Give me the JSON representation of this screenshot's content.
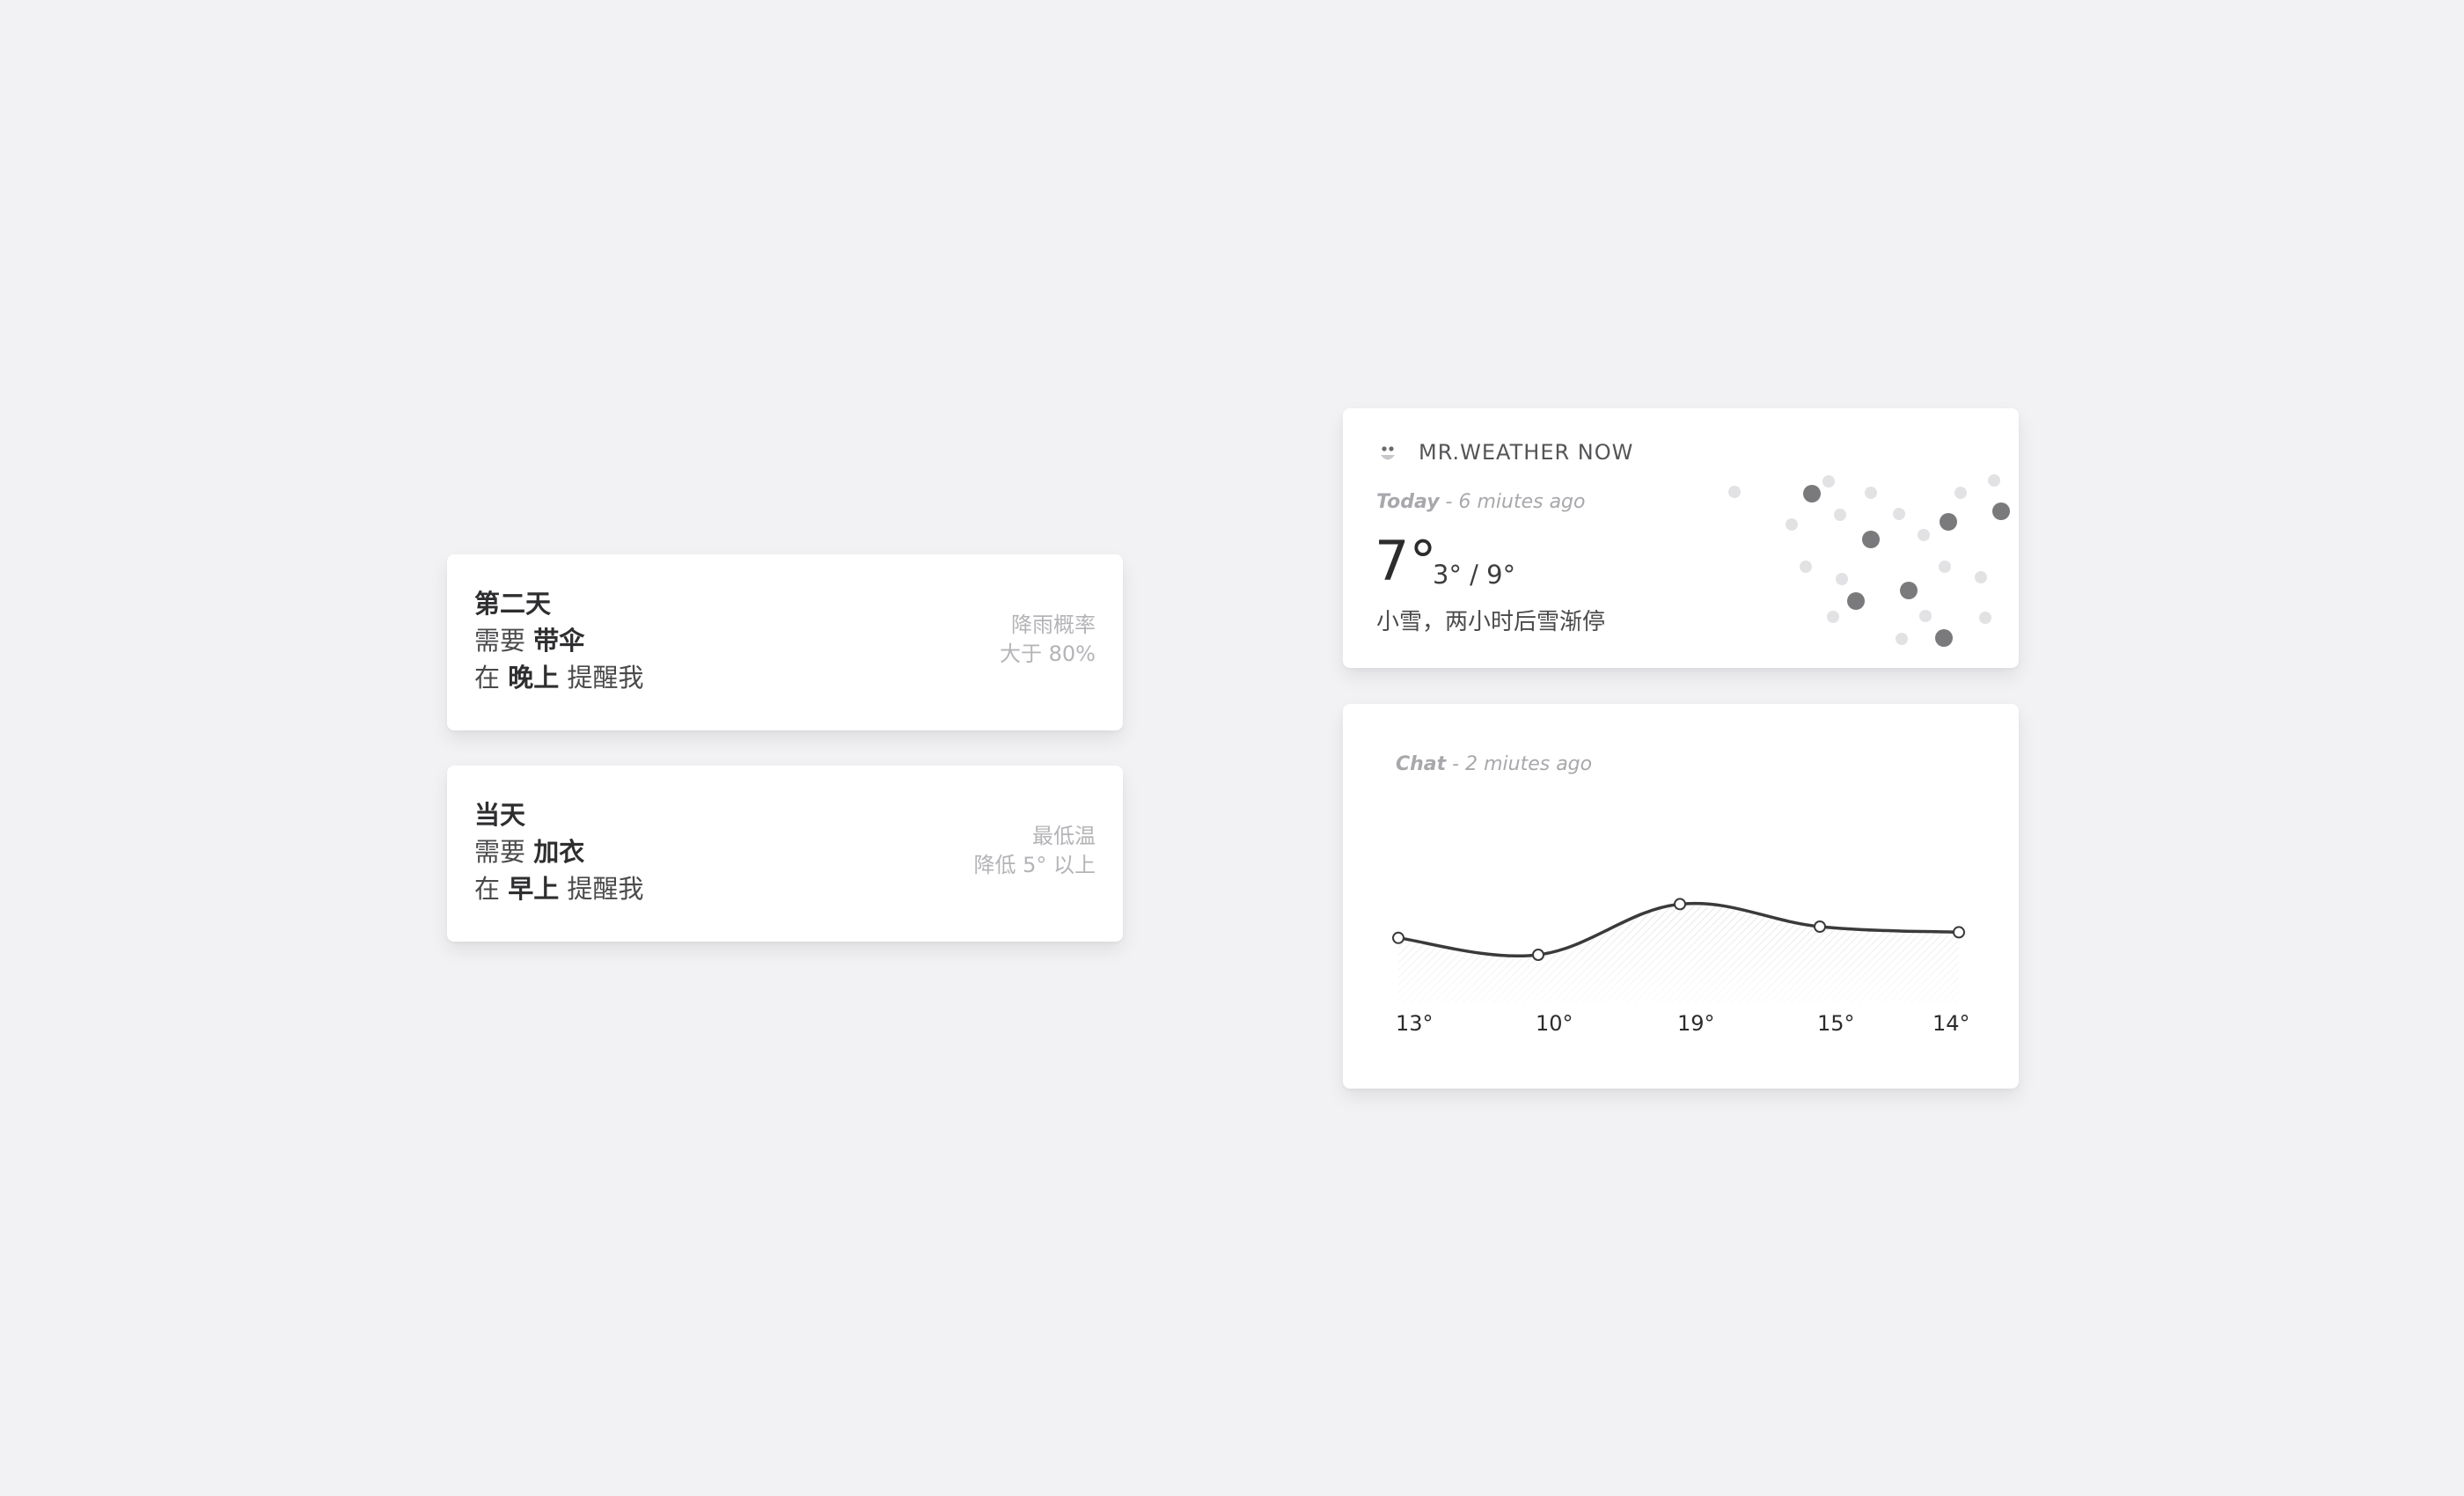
{
  "reminders": [
    {
      "title": "第二天",
      "line2_prefix": "需要",
      "line2_bold": "带伞",
      "line3_prefix": "在",
      "line3_bold": "晚上",
      "line3_suffix": "提醒我",
      "side_line1": "降雨概率",
      "side_line2": "大于 80%"
    },
    {
      "title": "当天",
      "line2_prefix": "需要",
      "line2_bold": "加衣",
      "line3_prefix": "在",
      "line3_bold": "早上",
      "line3_suffix": "提醒我",
      "side_line1": "最低温",
      "side_line2": "降低 5° 以上"
    }
  ],
  "weather": {
    "brand": "MR.WEATHER NOW",
    "time_label": "Today",
    "time_ago": "- 6 miutes ago",
    "temperature": "7°",
    "range": "3° / 9°",
    "description": "小雪，两小时后雪渐停",
    "colors": {
      "flake_light": "#e2e2e4",
      "flake_dark": "#7a7a7c"
    }
  },
  "chart": {
    "time_label": "Chat",
    "time_ago": "- 2 miutes ago"
  },
  "chart_data": {
    "type": "line",
    "categories": [
      "13°",
      "10°",
      "19°",
      "15°",
      "14°"
    ],
    "values": [
      13,
      10,
      19,
      15,
      14
    ],
    "title": "",
    "xlabel": "",
    "ylabel": "",
    "grid": false,
    "legend": "none",
    "colors": {
      "line": "#3a3a3c",
      "fill_hatch": "#d9d9dc"
    }
  }
}
